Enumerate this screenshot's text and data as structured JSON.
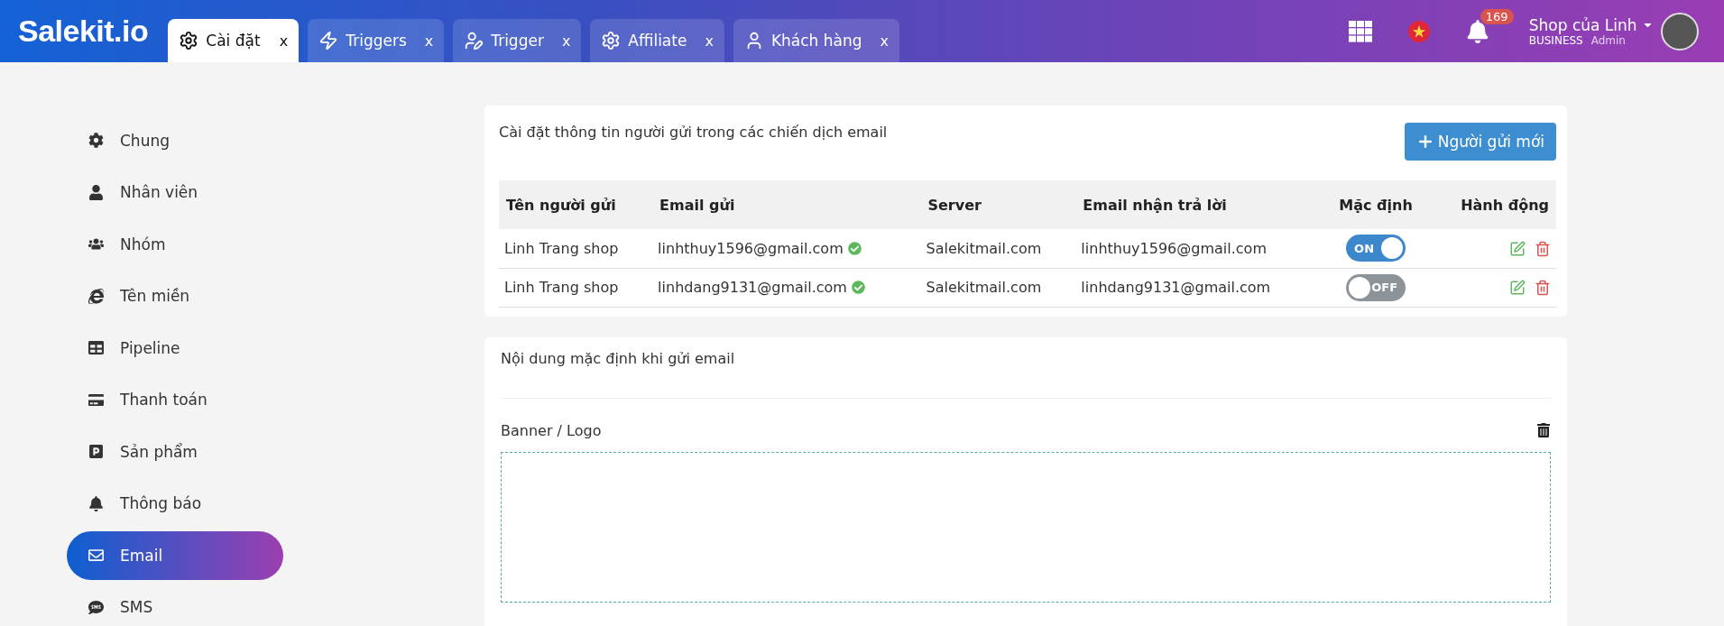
{
  "header": {
    "logo": "Salekit.io",
    "tabs": [
      {
        "label": "Cài đặt",
        "close": "x",
        "selected": true
      },
      {
        "label": "Triggers",
        "close": "x",
        "selected": false
      },
      {
        "label": "Trigger",
        "close": "x",
        "selected": false
      },
      {
        "label": "Affiliate",
        "close": "x",
        "selected": false
      },
      {
        "label": "Khách hàng",
        "close": "x",
        "selected": false
      }
    ],
    "notification_count": "169",
    "account": {
      "name": "Shop của Linh",
      "plan": "BUSINESS",
      "role": "Admin"
    }
  },
  "sidebar": {
    "items": [
      {
        "label": "Chung",
        "selected": false
      },
      {
        "label": "Nhân viên",
        "selected": false
      },
      {
        "label": "Nhóm",
        "selected": false
      },
      {
        "label": "Tên miền",
        "selected": false
      },
      {
        "label": "Pipeline",
        "selected": false
      },
      {
        "label": "Thanh toán",
        "selected": false
      },
      {
        "label": "Sản phẩm",
        "selected": false
      },
      {
        "label": "Thông báo",
        "selected": false
      },
      {
        "label": "Email",
        "selected": true
      },
      {
        "label": "SMS",
        "selected": false
      }
    ]
  },
  "senders": {
    "title": "Cài đặt thông tin người gửi trong các chiến dịch email",
    "new_button": "Người gửi mới",
    "columns": [
      "Tên người gửi",
      "Email gửi",
      "Server",
      "Email nhận trả lời",
      "Mặc định",
      "Hành động"
    ],
    "rows": [
      {
        "name": "Linh Trang shop",
        "email": "linhthuy1596@gmail.com",
        "verified": true,
        "server": "Salekitmail.com",
        "reply_to": "linhthuy1596@gmail.com",
        "default": {
          "on": true,
          "label": "ON"
        }
      },
      {
        "name": "Linh Trang shop",
        "email": "linhdang9131@gmail.com",
        "verified": true,
        "server": "Salekitmail.com",
        "reply_to": "linhdang9131@gmail.com",
        "default": {
          "on": false,
          "label": "OFF"
        }
      }
    ]
  },
  "content": {
    "title": "Nội dung mặc định khi gửi email",
    "banner_label": "Banner / Logo"
  }
}
